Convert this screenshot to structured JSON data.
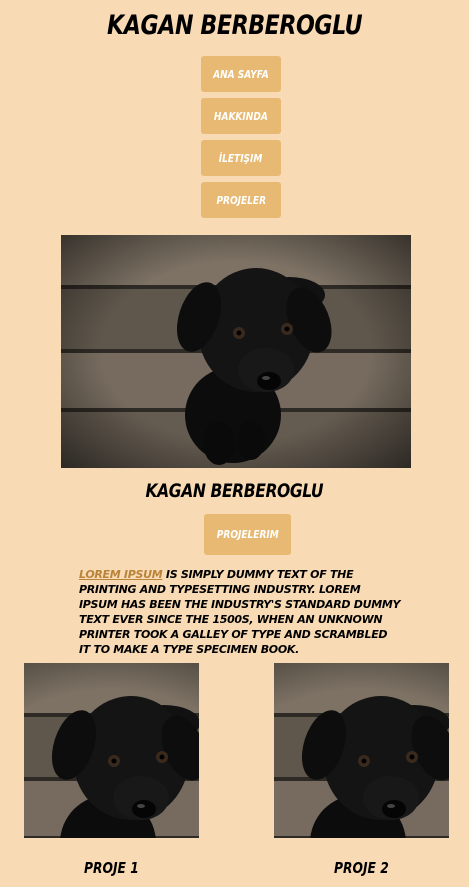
{
  "header": {
    "title": "Kagan Berberoglu"
  },
  "nav": {
    "items": [
      {
        "label": "Ana Sayfa"
      },
      {
        "label": "Hakkinda"
      },
      {
        "label": "İletişim"
      },
      {
        "label": "Projeler"
      }
    ]
  },
  "hero": {
    "image": "black-puppy-photo"
  },
  "profile": {
    "name": "Kagan Berberoglu",
    "button_label": "Projelerim"
  },
  "about": {
    "highlight": "Lorem Ipsum",
    "text": " is simply dummy text of the printing and typesetting industry. Lorem Ipsum has been the industry's standard dummy text ever since the 1500s, when an unknown printer took a galley of type and scrambled it to make a type specimen book."
  },
  "projects": [
    {
      "caption": "Proje 1",
      "image": "black-puppy-photo"
    },
    {
      "caption": "Proje 2",
      "image": "black-puppy-photo"
    }
  ],
  "colors": {
    "background": "#f8dab4",
    "button": "#e7b972",
    "button_text": "#ffffff",
    "highlight": "#b9843a"
  }
}
